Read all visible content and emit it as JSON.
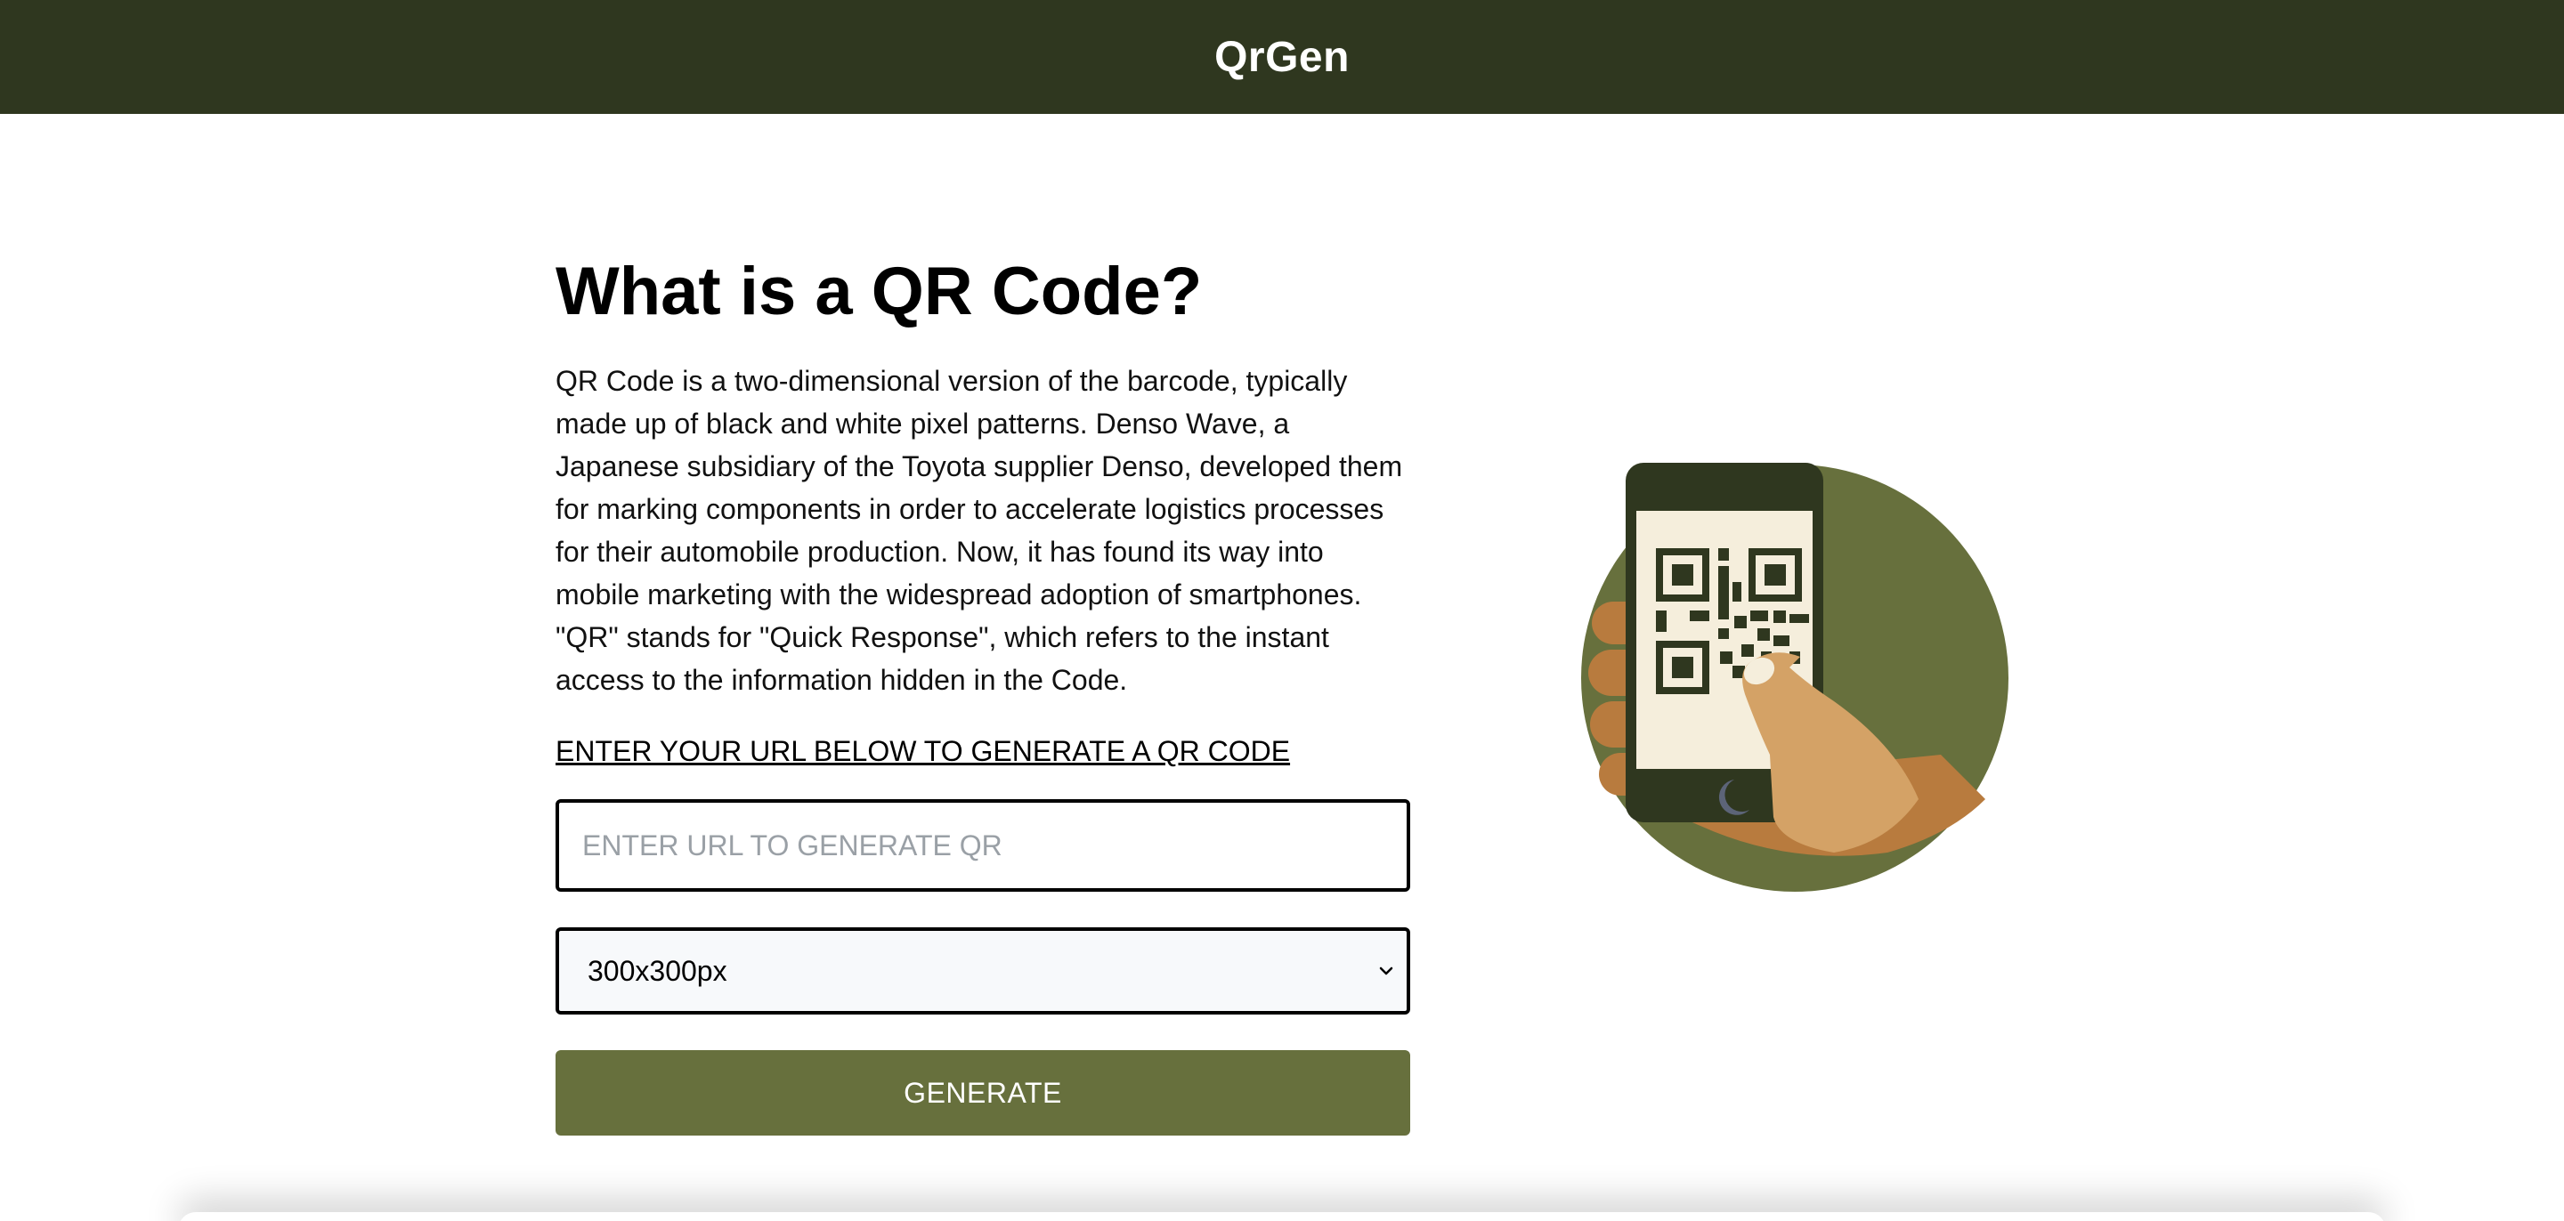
{
  "header": {
    "brand": "QrGen"
  },
  "main": {
    "title": "What is a QR Code?",
    "description": "QR Code is a two-dimensional version of the barcode, typically made up of black and white pixel patterns. Denso Wave, a Japanese subsidiary of the Toyota supplier Denso, developed them for marking components in order to accelerate logistics processes for their automobile production. Now, it has found its way into mobile marketing with the widespread adoption of smartphones. \"QR\" stands for \"Quick Response\", which refers to the instant access to the information hidden in the Code.",
    "cta_label": "ENTER YOUR URL BELOW TO GENERATE A QR CODE",
    "url_input": {
      "placeholder": "ENTER URL TO GENERATE QR",
      "value": ""
    },
    "size_select": {
      "selected": "300x300px"
    },
    "generate_label": "GENERATE"
  },
  "illustration": {
    "icon": "phone-scanning-qr-icon"
  },
  "colors": {
    "header_bg": "#2f371f",
    "accent": "#67703d",
    "phone": "#2f371f",
    "screen": "#f5eedc",
    "hand": "#d4a266",
    "hand_shadow": "#b87b3e"
  }
}
